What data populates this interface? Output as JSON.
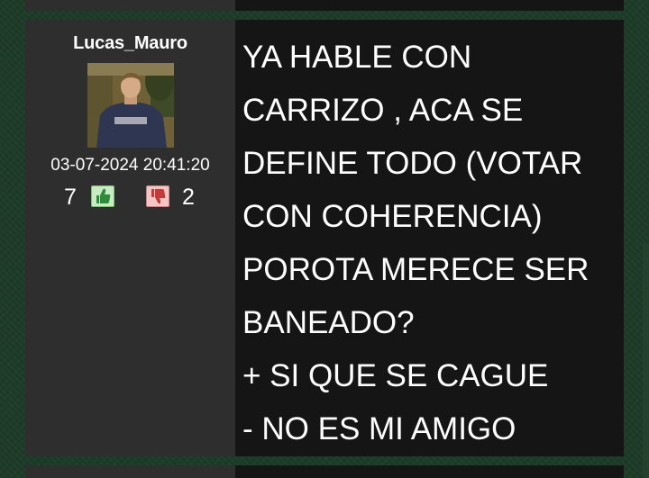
{
  "post": {
    "username": "Lucas_Mauro",
    "timestamp": "03-07-2024 20:41:20",
    "votes": {
      "up_count": "7",
      "down_count": "2"
    },
    "message_lines": [
      "YA HABLE CON",
      "CARRIZO , ACA SE",
      "DEFINE TODO (VOTAR",
      "CON COHERENCIA)",
      "POROTA MERECE SER",
      "BANEADO?",
      "+ SI QUE SE CAGUE",
      "- NO ES MI AMIGO"
    ]
  },
  "colors": {
    "background": "#1d3b28",
    "sidebar": "#2e2e2e",
    "content": "#151515",
    "text": "#ffffff",
    "upvote_bg": "#c9ebc4",
    "downvote_bg": "#f3c6c6"
  },
  "icons": {
    "upvote": "thumbs-up-icon",
    "downvote": "thumbs-down-icon"
  }
}
